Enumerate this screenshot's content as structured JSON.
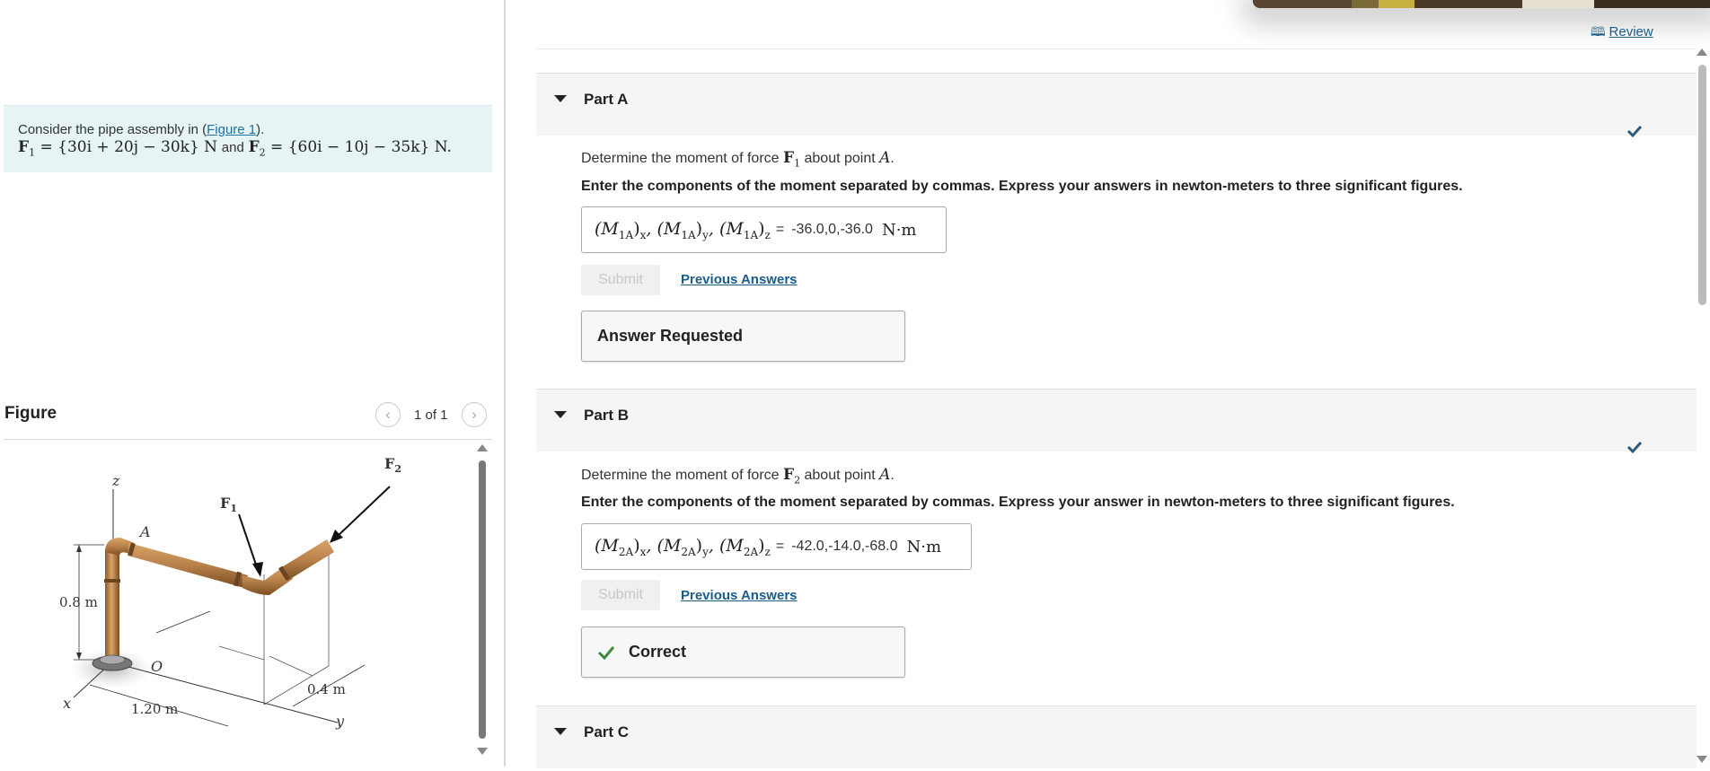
{
  "intro": {
    "text_before_link": "Consider the pipe assembly in (",
    "link": "Figure 1",
    "text_after_link": ").",
    "f1_label": "F",
    "f1_sub": "1",
    "f1_value": " = {30i + 20j − 30k} N",
    "and": "and",
    "f2_label": "F",
    "f2_sub": "2",
    "f2_value": " = {60i − 10j − 35k} N."
  },
  "figure": {
    "title": "Figure",
    "pager": "1 of 1",
    "labels": {
      "z": "z",
      "A": "A",
      "F1": "F",
      "F1_sub": "1",
      "F2": "F",
      "F2_sub": "2",
      "height": "0.8 m",
      "O": "O",
      "x": "x",
      "len1": "1.20 m",
      "len2": "0.4 m",
      "y": "y"
    }
  },
  "header": {
    "review": "Review"
  },
  "parts": [
    {
      "title": "Part A",
      "prompt_pre": "Determine the moment of force ",
      "force": "F",
      "force_sub": "1",
      "prompt_mid": " about point ",
      "point": "A",
      "prompt_end": ".",
      "instruction": "Enter the components of the moment separated by commas. Express your answers in newton-meters to three significant figures.",
      "lhs": [
        "(M",
        "1A",
        ")",
        "x",
        ", (M",
        "1A",
        ")",
        "y",
        ", (M",
        "1A",
        ")",
        "z"
      ],
      "equals": "=",
      "value": "-36.0,0,-36.0",
      "unit": "N·m",
      "submit": "Submit",
      "previous": "Previous Answers",
      "feedback": "Answer Requested"
    },
    {
      "title": "Part B",
      "prompt_pre": "Determine the moment of force ",
      "force": "F",
      "force_sub": "2",
      "prompt_mid": " about point ",
      "point": "A",
      "prompt_end": ".",
      "instruction": "Enter the components of the moment separated by commas. Express your answer in newton-meters to three significant figures.",
      "lhs": [
        "(M",
        "2A",
        ")",
        "x",
        ", (M",
        "2A",
        ")",
        "y",
        ", (M",
        "2A",
        ")",
        "z"
      ],
      "equals": "=",
      "value": "-42.0,-14.0,-68.0",
      "unit": "N·m",
      "submit": "Submit",
      "previous": "Previous Answers",
      "feedback": "Correct"
    },
    {
      "title": "Part C"
    }
  ],
  "colors": {
    "accent_link": "#1a5c8a",
    "check": "#2f5a7a",
    "correct_green": "#3c8a3c",
    "intro_bg": "#e6f4f5",
    "pipe": "#b8804a"
  },
  "icons": [
    "book-icon",
    "chevron-left-icon",
    "chevron-right-icon",
    "caret-down-icon",
    "checkmark-icon",
    "scroll-up-icon",
    "scroll-down-icon"
  ]
}
